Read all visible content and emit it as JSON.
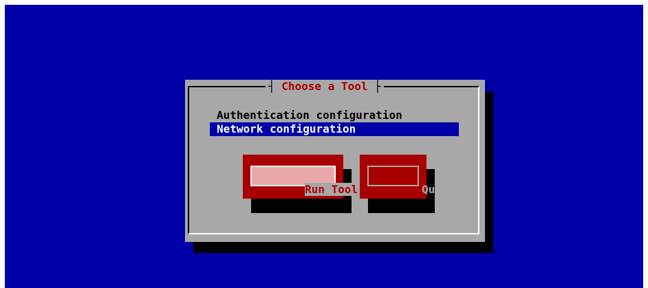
{
  "dialog": {
    "title": "Choose a Tool",
    "items": [
      {
        "label": "Authentication configuration",
        "selected": false
      },
      {
        "label": "Network configuration",
        "selected": true
      }
    ],
    "buttons": {
      "run_tool": "Run Tool",
      "quit": "Quit"
    }
  },
  "colors": {
    "background": "#0000a8",
    "dialog": "#a8a8a8",
    "title": "#a80000",
    "button": "#a80000",
    "selection": "#0000a8"
  }
}
